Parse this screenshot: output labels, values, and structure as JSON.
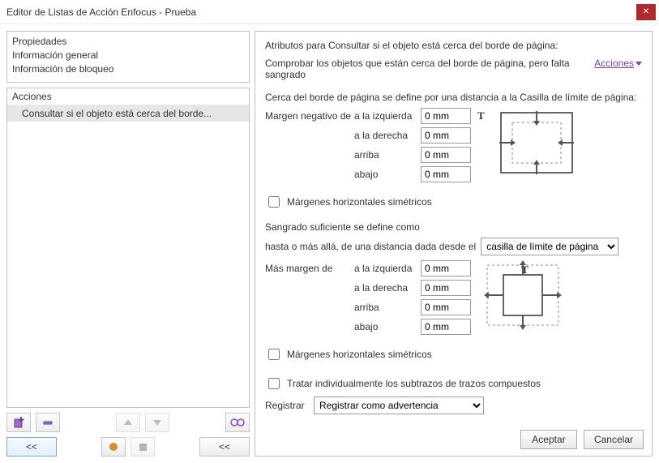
{
  "window": {
    "title": "Editor de Listas de Acción Enfocus - Prueba"
  },
  "left": {
    "props_header": "Propiedades",
    "props_items": [
      "Información general",
      "Información de bloqueo"
    ],
    "actions_header": "Acciones",
    "action_items": [
      "Consultar si el objeto está cerca del borde..."
    ]
  },
  "attrs": {
    "title": "Atributos para Consultar si el objeto está cerca del borde de página:",
    "description": "Comprobar los objetos que están cerca del borde de página, pero falta sangrado",
    "actions_link": "Acciones",
    "section1_text": "Cerca del borde de página se define por una distancia a la Casilla de límite de página:",
    "neg_margin_lead": "Margen negativo de",
    "labels": {
      "left": "a la izquierda",
      "right": "a la derecha",
      "top": "arriba",
      "bottom": "abajo"
    },
    "margins1": {
      "left": "0 mm",
      "right": "0 mm",
      "top": "0 mm",
      "bottom": "0 mm"
    },
    "sym_h_margins": "Márgenes horizontales simétricos",
    "section2a": "Sangrado suficiente se define como",
    "section2b_prefix": "hasta o más allá, de una distancia dada desde el",
    "box_select": "casilla de límite de página",
    "more_margin_lead": "Más margen de",
    "margins2": {
      "left": "0 mm",
      "right": "0 mm",
      "top": "0 mm",
      "bottom": "0 mm"
    },
    "treat_individually": "Tratar individualmente los subtrazos de trazos compuestos",
    "log_label": "Registrar",
    "log_value": "Registrar como advertencia"
  },
  "buttons": {
    "ok": "Aceptar",
    "cancel": "Cancelar",
    "back": "<<"
  },
  "icons": {
    "add": "add-action-icon",
    "remove": "remove-action-icon",
    "up": "move-up-icon",
    "down": "move-down-icon",
    "glasses": "inspect-icon",
    "record": "record-icon",
    "stop": "stop-icon"
  }
}
